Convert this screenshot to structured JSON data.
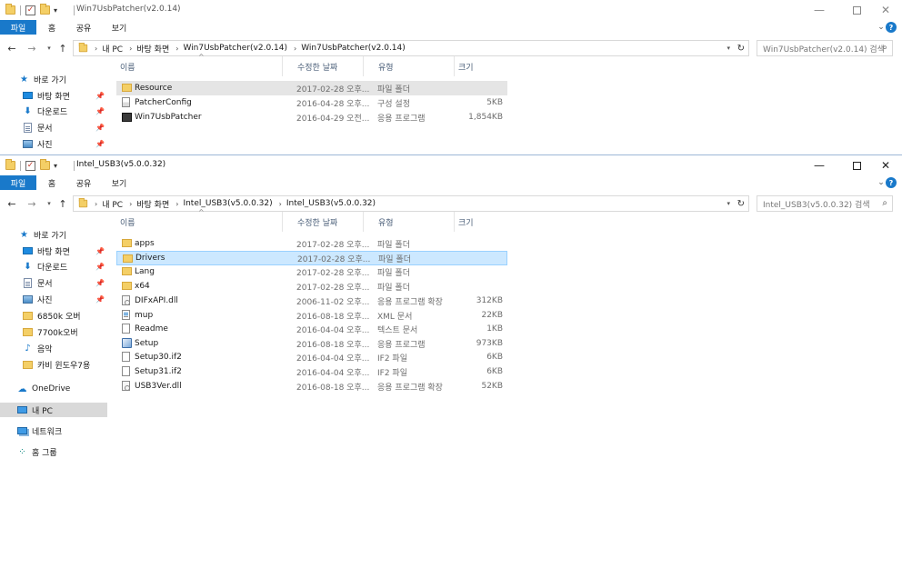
{
  "windows": [
    {
      "id": "w1",
      "title": "Win7UsbPatcher(v2.0.14)",
      "ribbon_tabs": [
        "파일",
        "홈",
        "공유",
        "보기"
      ],
      "breadcrumb": [
        "내 PC",
        "바탕 화면",
        "Win7UsbPatcher(v2.0.14)",
        "Win7UsbPatcher(v2.0.14)"
      ],
      "search_placeholder": "Win7UsbPatcher(v2.0.14) 검색",
      "columns": [
        "이름",
        "수정한 날짜",
        "유형",
        "크기"
      ],
      "nav_items": [
        {
          "label": "바로 가기",
          "icon": "star-icon",
          "pinned": false
        },
        {
          "label": "바탕 화면",
          "icon": "desktop-icon",
          "pinned": true
        },
        {
          "label": "다운로드",
          "icon": "download-icon",
          "pinned": true
        },
        {
          "label": "문서",
          "icon": "documents-icon",
          "pinned": true
        },
        {
          "label": "사진",
          "icon": "pictures-icon",
          "pinned": true
        }
      ],
      "files": [
        {
          "name": "Resource",
          "date": "2017-02-28 오후...",
          "type": "파일 폴더",
          "size": "",
          "icon": "folder-icon"
        },
        {
          "name": "PatcherConfig",
          "date": "2016-04-28 오후...",
          "type": "구성 설정",
          "size": "5KB",
          "icon": "config-file-icon"
        },
        {
          "name": "Win7UsbPatcher",
          "date": "2016-04-29 오전...",
          "type": "응용 프로그램",
          "size": "1,854KB",
          "icon": "application-icon"
        }
      ]
    },
    {
      "id": "w2",
      "title": "Intel_USB3(v5.0.0.32)",
      "ribbon_tabs": [
        "파일",
        "홈",
        "공유",
        "보기"
      ],
      "breadcrumb": [
        "내 PC",
        "바탕 화면",
        "Intel_USB3(v5.0.0.32)",
        "Intel_USB3(v5.0.0.32)"
      ],
      "search_placeholder": "Intel_USB3(v5.0.0.32) 검색",
      "columns": [
        "이름",
        "수정한 날짜",
        "유형",
        "크기"
      ],
      "nav_items": [
        {
          "label": "바로 가기",
          "icon": "star-icon",
          "pinned": false
        },
        {
          "label": "바탕 화면",
          "icon": "desktop-icon",
          "pinned": true
        },
        {
          "label": "다운로드",
          "icon": "download-icon",
          "pinned": true
        },
        {
          "label": "문서",
          "icon": "documents-icon",
          "pinned": true
        },
        {
          "label": "사진",
          "icon": "pictures-icon",
          "pinned": true
        },
        {
          "label": "6850k 오버",
          "icon": "folder-icon",
          "pinned": false
        },
        {
          "label": "7700k오버",
          "icon": "folder-icon",
          "pinned": false
        },
        {
          "label": "음악",
          "icon": "music-icon",
          "pinned": false
        },
        {
          "label": "카비 윈도우7용",
          "icon": "folder-icon",
          "pinned": false
        },
        {
          "label": "OneDrive",
          "icon": "onedrive-icon",
          "pinned": false
        },
        {
          "label": "내 PC",
          "icon": "this-pc-icon",
          "pinned": false
        },
        {
          "label": "네트워크",
          "icon": "network-icon",
          "pinned": false
        },
        {
          "label": "홈 그룹",
          "icon": "homegroup-icon",
          "pinned": false
        }
      ],
      "files": [
        {
          "name": "apps",
          "date": "2017-02-28 오후...",
          "type": "파일 폴더",
          "size": "",
          "icon": "folder-icon"
        },
        {
          "name": "Drivers",
          "date": "2017-02-28 오후...",
          "type": "파일 폴더",
          "size": "",
          "icon": "folder-icon"
        },
        {
          "name": "Lang",
          "date": "2017-02-28 오후...",
          "type": "파일 폴더",
          "size": "",
          "icon": "folder-icon"
        },
        {
          "name": "x64",
          "date": "2017-02-28 오후...",
          "type": "파일 폴더",
          "size": "",
          "icon": "folder-icon"
        },
        {
          "name": "DIFxAPI.dll",
          "date": "2006-11-02 오후...",
          "type": "응용 프로그램 확장",
          "size": "312KB",
          "icon": "dll-file-icon"
        },
        {
          "name": "mup",
          "date": "2016-08-18 오후...",
          "type": "XML 문서",
          "size": "22KB",
          "icon": "xml-file-icon"
        },
        {
          "name": "Readme",
          "date": "2016-04-04 오후...",
          "type": "텍스트 문서",
          "size": "1KB",
          "icon": "text-file-icon"
        },
        {
          "name": "Setup",
          "date": "2016-08-18 오후...",
          "type": "응용 프로그램",
          "size": "973KB",
          "icon": "setup-icon"
        },
        {
          "name": "Setup30.if2",
          "date": "2016-04-04 오후...",
          "type": "IF2 파일",
          "size": "6KB",
          "icon": "file-icon"
        },
        {
          "name": "Setup31.if2",
          "date": "2016-04-04 오후...",
          "type": "IF2 파일",
          "size": "6KB",
          "icon": "file-icon"
        },
        {
          "name": "USB3Ver.dll",
          "date": "2016-08-18 오후...",
          "type": "응용 프로그램 확장",
          "size": "52KB",
          "icon": "dll-file-icon"
        }
      ]
    }
  ],
  "colors": {
    "accent": "#1979ca",
    "selection_fill": "#cce8ff",
    "selection_border": "#99d1ff",
    "hover_fill": "#e5e5e5"
  }
}
